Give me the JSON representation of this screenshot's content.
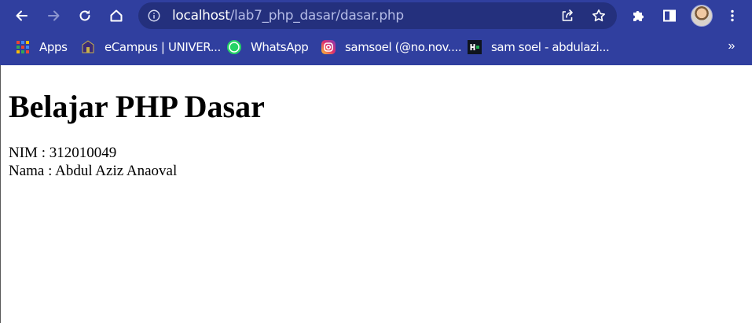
{
  "browser": {
    "url_host": "localhost",
    "url_path": "/lab7_php_dasar/dasar.php",
    "icons": {
      "back": "back-arrow-icon",
      "forward": "forward-arrow-icon",
      "reload": "reload-icon",
      "home": "home-icon",
      "site_info": "info-icon",
      "share": "share-icon",
      "bookmark": "star-icon",
      "extensions": "puzzle-icon",
      "side_panel": "side-panel-icon",
      "menu": "kebab-menu-icon"
    },
    "colors": {
      "frame": "#303f9f",
      "omnibox": "#24307d",
      "url_path": "#b4bbe6"
    }
  },
  "bookmarks": {
    "items": [
      {
        "label": "Apps",
        "icon": "apps-grid-icon"
      },
      {
        "label": "eCampus | UNIVER...",
        "icon": "university-logo-icon"
      },
      {
        "label": "WhatsApp",
        "icon": "whatsapp-icon"
      },
      {
        "label": "samsoel (@no.nov....",
        "icon": "instagram-icon"
      },
      {
        "label": "sam soel - abdulazi...",
        "icon": "hackerrank-icon"
      }
    ],
    "overflow_label": "»"
  },
  "page": {
    "heading": "Belajar PHP Dasar",
    "nim_line": "NIM : 312010049",
    "nama_line": "Nama : Abdul Aziz Anaoval"
  }
}
